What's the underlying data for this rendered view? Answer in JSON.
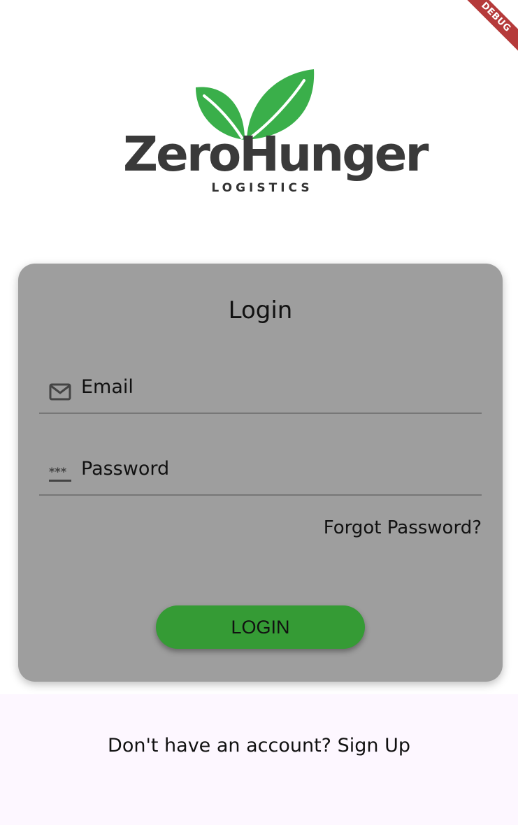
{
  "debug_banner": "DEBUG",
  "logo": {
    "brand": "ZeroHunger",
    "subtitle": "LOGISTICS",
    "leaf_color": "#3aaf4a",
    "text_color": "#3a3a3a"
  },
  "login_card": {
    "title": "Login",
    "background": "#9e9e9e",
    "email": {
      "label": "Email",
      "icon": "email-icon"
    },
    "password": {
      "label": "Password",
      "icon": "password-icon"
    },
    "forgot_password": "Forgot Password?",
    "login_button": {
      "label": "LOGIN",
      "color": "#359b35"
    }
  },
  "footer": {
    "signup_text": "Don't have an account? Sign Up",
    "background": "#fdf7ff"
  }
}
